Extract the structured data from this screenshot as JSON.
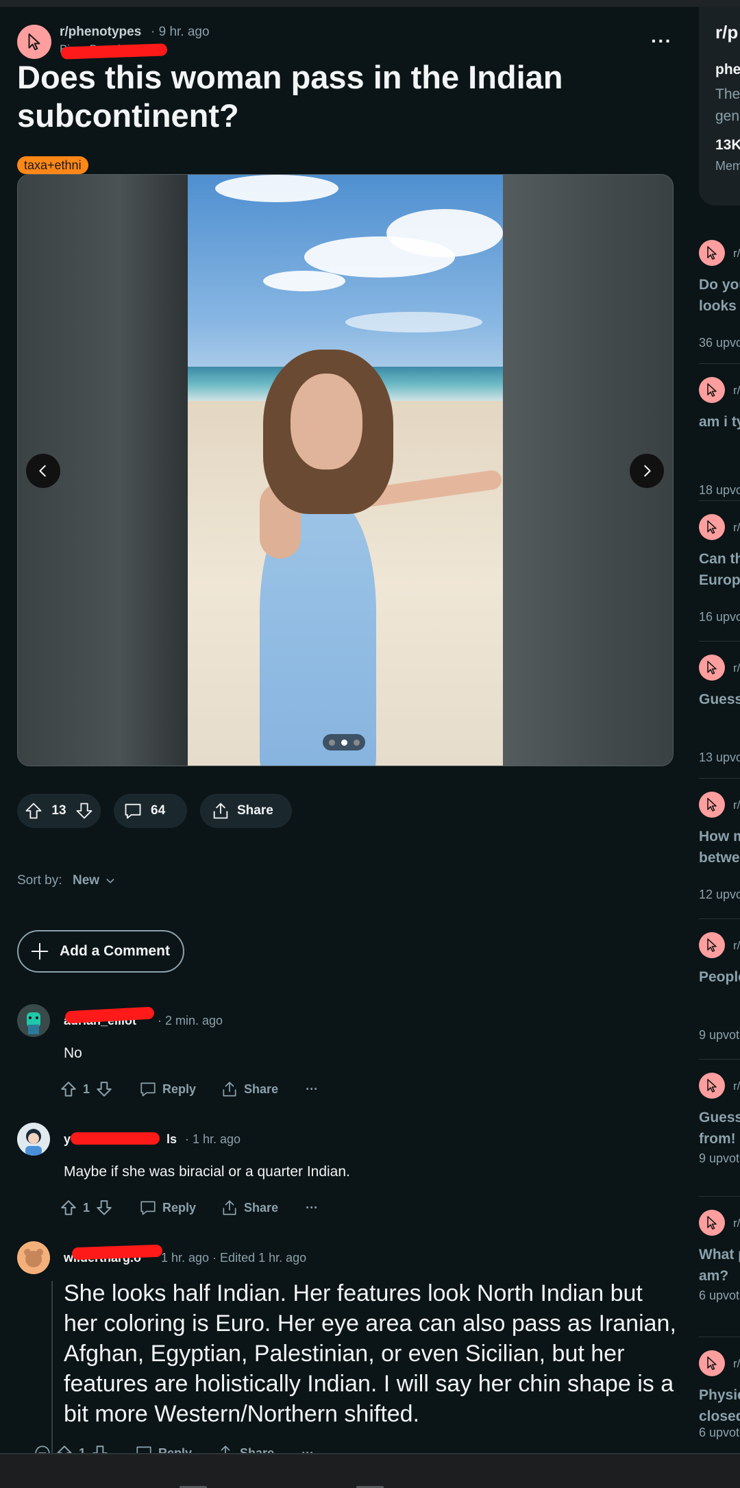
{
  "post": {
    "subreddit": "r/phenotypes",
    "time": "· 9 hr. ago",
    "author_partial": "BingoBoards",
    "title": "Does this woman pass in the Indian subcontinent?",
    "flair": "taxa+ethni",
    "more": "···",
    "gallery": {
      "total_images": 3,
      "current_index": 2
    },
    "votes": "13",
    "comments": "64",
    "share": "Share"
  },
  "sort": {
    "label": "Sort by:",
    "value": "New"
  },
  "add_comment": {
    "label": "Add a Comment"
  },
  "comments": [
    {
      "author": "adrian_elliot",
      "time": "· 2 min. ago",
      "body": "No",
      "votes": "1",
      "reply": "Reply",
      "share": "Share",
      "more": "···"
    },
    {
      "author": "y",
      "author_suffix": "ls",
      "time": "· 1 hr. ago",
      "body": "Maybe if she was biracial or a quarter Indian.",
      "votes": "1",
      "reply": "Reply",
      "share": "Share",
      "more": "···"
    },
    {
      "author": "wildertharg.o",
      "time": "1 hr. ago · Edited 1 hr. ago",
      "body": "She looks half Indian. Her features look North Indian but her coloring is Euro. Her eye area can also pass as Iranian, Afghan, Egyptian, Palestinian, or even Sicilian, but her features are holistically Indian. I will say her chin shape is a bit more Western/Northern shifted.",
      "votes": "1",
      "reply": "Reply",
      "share": "Share",
      "more": "···"
    }
  ],
  "sidebar": {
    "card": {
      "title": "r/p",
      "name": "phe",
      "desc_1": "The",
      "desc_2": "gen",
      "members_count": "13K",
      "members_label": "Mem"
    },
    "related": [
      {
        "sub": "r/",
        "title_1": "Do you",
        "title_2": "looks",
        "upvotes": "36 upvo"
      },
      {
        "sub": "r/",
        "title_1": "am i ty",
        "title_2": "",
        "upvotes": "18 upvo"
      },
      {
        "sub": "r/",
        "title_1": "Can th",
        "title_2": "Europ",
        "upvotes": "16 upvo"
      },
      {
        "sub": "r/",
        "title_1": "Guess",
        "title_2": "",
        "upvotes": "13 upvo"
      },
      {
        "sub": "r/",
        "title_1": "How m",
        "title_2": "betwe",
        "upvotes": "12 upvo"
      },
      {
        "sub": "r/",
        "title_1": "People",
        "title_2": "",
        "upvotes": "9 upvot"
      },
      {
        "sub": "r/",
        "title_1": "Guess",
        "title_2": "from!",
        "upvotes": "9 upvot"
      },
      {
        "sub": "r/",
        "title_1": "What p",
        "title_2": "am?",
        "upvotes": "6 upvot"
      },
      {
        "sub": "r/",
        "title_1": "Physic",
        "title_2": "closed",
        "upvotes": "6 upvot"
      }
    ]
  },
  "colors": {
    "background": "#0b1416",
    "pill": "#1a282d",
    "flair": "#ff8717",
    "sub_avatar": "#ff9e9e",
    "redaction": "#ff1a1a",
    "muted_text": "#8ba2ad"
  },
  "icons": {
    "subreddit_avatar": "cursor-arrow-icon",
    "upvote": "arrow-up-icon",
    "downvote": "arrow-down-icon",
    "comment": "speech-bubble-icon",
    "share": "share-upload-icon",
    "add": "plus-icon",
    "prev": "chevron-left-icon",
    "next": "chevron-right-icon",
    "sort": "chevron-down-icon",
    "collapse": "minus-circle-icon"
  }
}
